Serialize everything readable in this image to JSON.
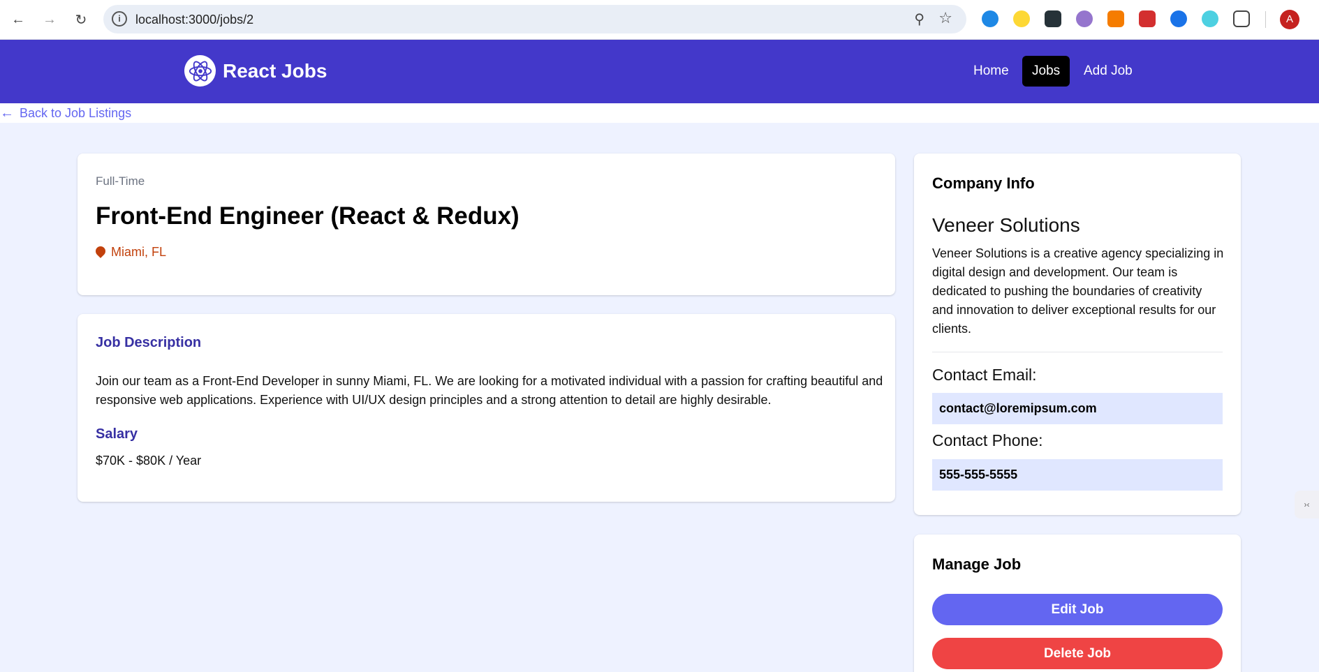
{
  "browser": {
    "url": "localhost:3000/jobs/2",
    "avatar_letter": "A"
  },
  "navbar": {
    "brand": "React Jobs",
    "links": [
      {
        "label": "Home"
      },
      {
        "label": "Jobs",
        "active": true
      },
      {
        "label": "Add Job"
      }
    ]
  },
  "back": {
    "label": "Back to Job Listings"
  },
  "job": {
    "type": "Full-Time",
    "title": "Front-End Engineer (React & Redux)",
    "location": "Miami, FL",
    "description_heading": "Job Description",
    "description": "Join our team as a Front-End Developer in sunny Miami, FL. We are looking for a motivated individual with a passion for crafting beautiful and responsive web applications. Experience with UI/UX design principles and a strong attention to detail are highly desirable.",
    "salary_heading": "Salary",
    "salary": "$70K - $80K / Year"
  },
  "company": {
    "heading": "Company Info",
    "name": "Veneer Solutions",
    "description": "Veneer Solutions is a creative agency specializing in digital design and development. Our team is dedicated to pushing the boundaries of creativity and innovation to deliver exceptional results for our clients.",
    "email_label": "Contact Email:",
    "email": "contact@loremipsum.com",
    "phone_label": "Contact Phone:",
    "phone": "555-555-5555"
  },
  "manage": {
    "heading": "Manage Job",
    "edit_label": "Edit Job",
    "delete_label": "Delete Job"
  },
  "colors": {
    "navbar": "#4338ca",
    "accent": "#6366f1",
    "danger": "#ef4444",
    "location": "#c2410c"
  }
}
